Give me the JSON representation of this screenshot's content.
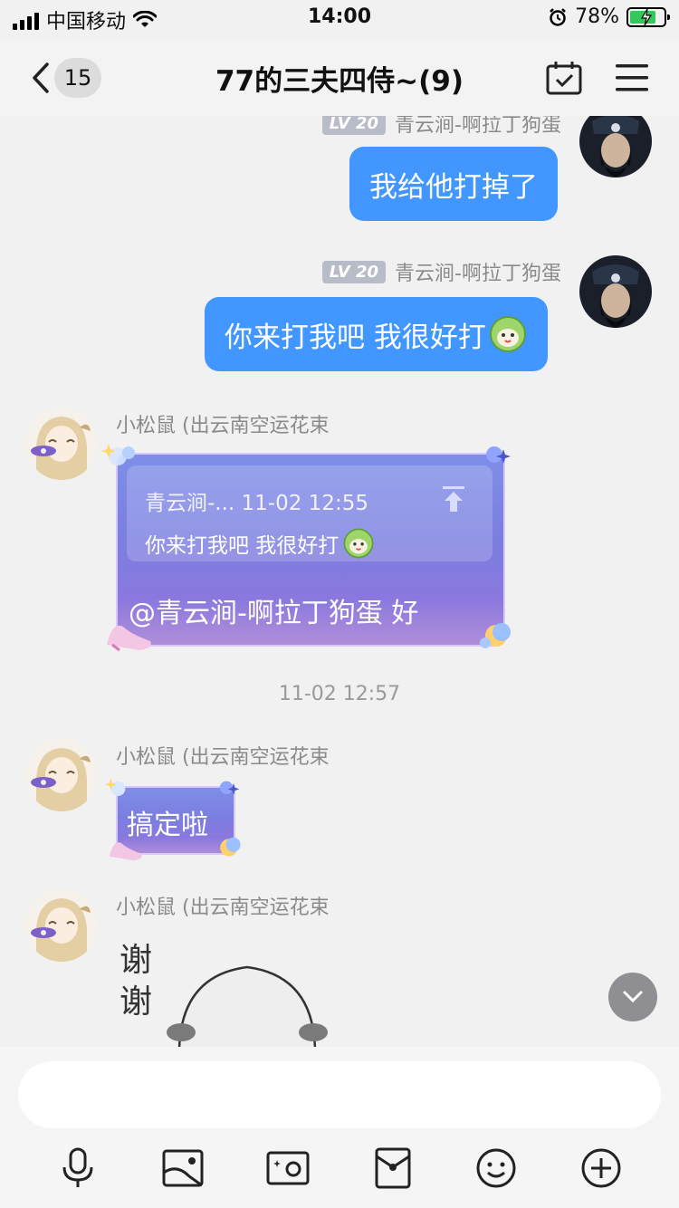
{
  "status_bar": {
    "carrier": "中国移动",
    "time": "14:00",
    "battery": "78%",
    "battery_level": 0.78
  },
  "header": {
    "unread_count": "15",
    "title": "77的三夫四侍~(9)"
  },
  "messages": [
    {
      "sender": "青云涧-啊拉丁狗蛋",
      "level": "LV 20",
      "text": "我给他打掉了"
    },
    {
      "sender": "青云涧-啊拉丁狗蛋",
      "level": "LV 20",
      "text": "你来打我吧 我很好打"
    },
    {
      "sender": "小松鼠 (出云南空运花束",
      "quote_head": "青云涧-... 11-02 12:55",
      "quote_body": "你来打我吧 我很好打",
      "text": "@青云涧-啊拉丁狗蛋 好"
    },
    {
      "timestamp": "11-02 12:57"
    },
    {
      "sender": "小松鼠 (出云南空运花束",
      "text": "搞定啦"
    },
    {
      "sender": "小松鼠 (出云南空运花束",
      "sticker_text": "谢谢"
    }
  ],
  "input": {
    "placeholder": ""
  },
  "toolbar": [
    "mic-icon",
    "image-icon",
    "camera-icon",
    "red-packet-icon",
    "emoji-icon",
    "plus-icon"
  ]
}
